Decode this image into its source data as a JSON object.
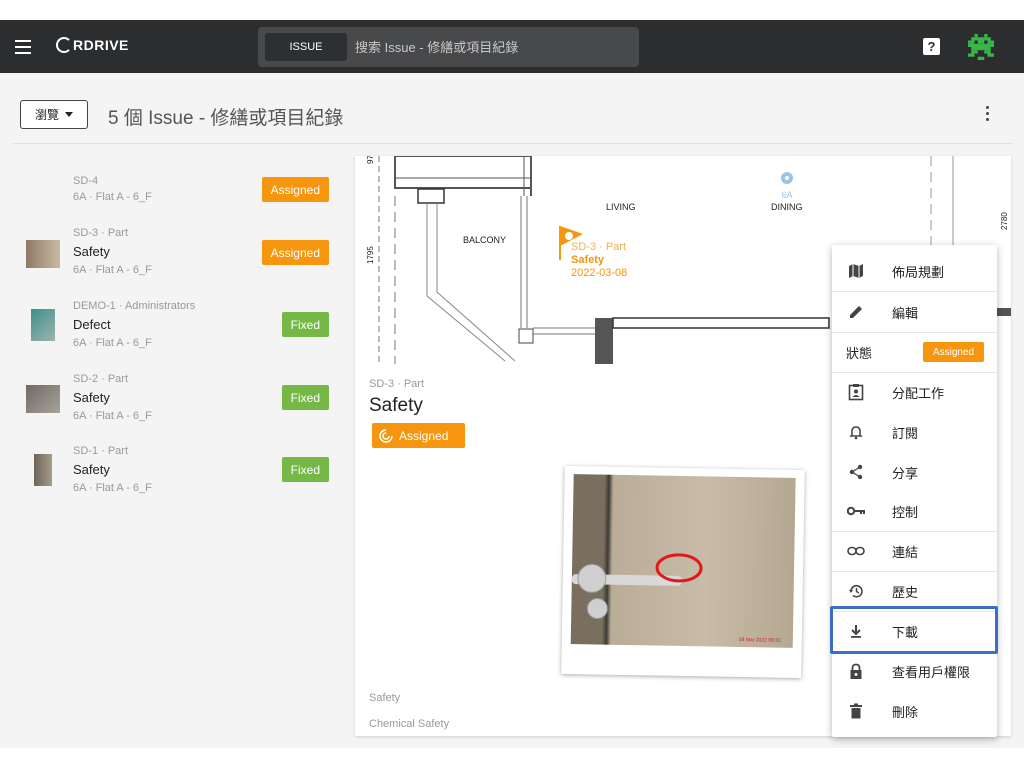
{
  "topbar": {
    "brand": "RDRIVE",
    "search_chip": "ISSUE",
    "search_placeholder": "搜索 Issue - 修繕或項目紀錄",
    "help_glyph": "?"
  },
  "toolbar": {
    "browse_label": "瀏覽",
    "page_title": "5 個 Issue - 修繕或項目紀錄"
  },
  "issues": [
    {
      "meta": "SD-4",
      "title": "",
      "location": "6A · Flat A - 6_F",
      "status": "Assigned"
    },
    {
      "meta": "SD-3 · Part",
      "title": "Safety",
      "location": "6A · Flat A - 6_F",
      "status": "Assigned"
    },
    {
      "meta": "DEMO-1 · Administrators",
      "title": "Defect",
      "location": "6A · Flat A - 6_F",
      "status": "Fixed"
    },
    {
      "meta": "SD-2 · Part",
      "title": "Safety",
      "location": "6A · Flat A - 6_F",
      "status": "Fixed"
    },
    {
      "meta": "SD-1 · Part",
      "title": "Safety",
      "location": "6A · Flat A - 6_F",
      "status": "Fixed"
    }
  ],
  "plan": {
    "labels": {
      "living": "LIVING",
      "dining": "DINING",
      "balcony": "BALCONY",
      "dim1": "1795",
      "dim2": "2780",
      "dim3": "97",
      "room6a": "6A"
    },
    "pin": {
      "meta": "SD-3 · Part",
      "title": "Safety",
      "date": "2022-03-08"
    }
  },
  "detail": {
    "meta": "SD-3 · Part",
    "title": "Safety",
    "status": "Assigned",
    "category": "Safety",
    "subcategory": "Chemical Safety",
    "photo_stamp": "08 Mar 2022 09:31"
  },
  "menu": {
    "items": [
      {
        "label": "佈局規劃",
        "icon": "map-icon"
      },
      {
        "label": "編輯",
        "icon": "pencil-icon"
      },
      {
        "label": "分配工作",
        "icon": "assignment-icon"
      },
      {
        "label": "訂閱",
        "icon": "bell-icon"
      },
      {
        "label": "分享",
        "icon": "share-icon"
      },
      {
        "label": "控制",
        "icon": "key-icon"
      },
      {
        "label": "連結",
        "icon": "link-icon"
      },
      {
        "label": "歷史",
        "icon": "history-icon"
      },
      {
        "label": "下載",
        "icon": "download-icon"
      },
      {
        "label": "查看用戶權限",
        "icon": "lock-icon"
      },
      {
        "label": "刪除",
        "icon": "trash-icon"
      }
    ],
    "status_label": "狀態",
    "status_value": "Assigned"
  },
  "colors": {
    "topbar": "#2b2d2f",
    "assigned": "#f5960e",
    "fixed": "#76b846",
    "highlight": "#3a6fc4"
  }
}
